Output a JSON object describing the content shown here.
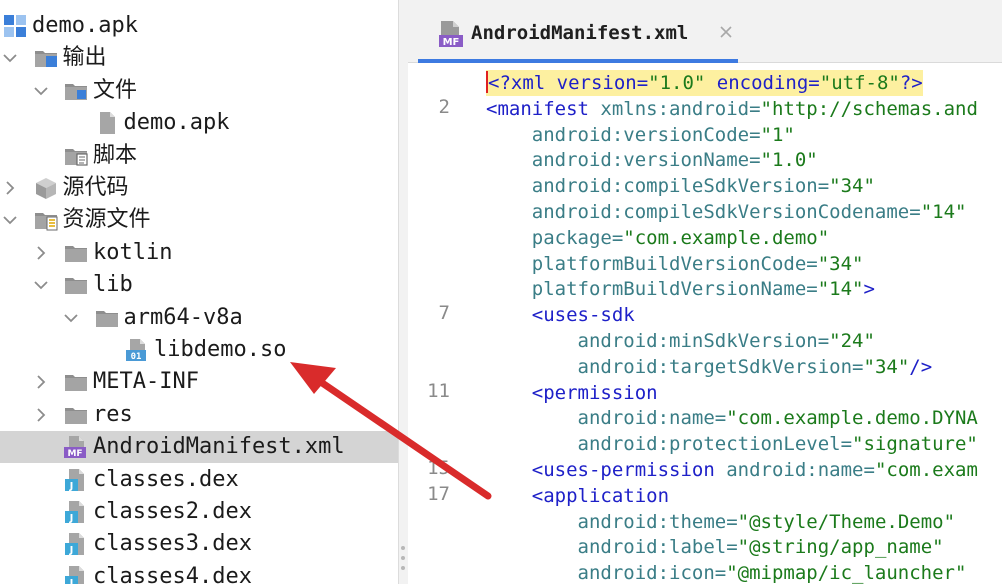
{
  "tree": {
    "items": [
      {
        "label": "demo.apk",
        "chevron": "none",
        "icon": "apk-module-icon",
        "depth": 0
      },
      {
        "label": "输出",
        "chevron": "down",
        "icon": "output-folder-icon",
        "depth": 1
      },
      {
        "label": "文件",
        "chevron": "down",
        "icon": "files-folder-icon",
        "depth": 2
      },
      {
        "label": "demo.apk",
        "chevron": "none",
        "icon": "file-icon",
        "depth": 3
      },
      {
        "label": "脚本",
        "chevron": "none",
        "icon": "script-folder-icon",
        "depth": 2
      },
      {
        "label": "源代码",
        "chevron": "right",
        "icon": "source-package-icon",
        "depth": 1
      },
      {
        "label": "资源文件",
        "chevron": "down",
        "icon": "resources-folder-icon",
        "depth": 1
      },
      {
        "label": "kotlin",
        "chevron": "right",
        "icon": "folder-icon",
        "depth": 2
      },
      {
        "label": "lib",
        "chevron": "down",
        "icon": "folder-icon",
        "depth": 2
      },
      {
        "label": "arm64-v8a",
        "chevron": "down",
        "icon": "folder-icon",
        "depth": 3
      },
      {
        "label": "libdemo.so",
        "chevron": "none",
        "icon": "binary-file-icon",
        "depth": 4
      },
      {
        "label": "META-INF",
        "chevron": "right",
        "icon": "folder-icon",
        "depth": 2
      },
      {
        "label": "res",
        "chevron": "right",
        "icon": "folder-icon",
        "depth": 2
      },
      {
        "label": "AndroidManifest.xml",
        "chevron": "none",
        "icon": "manifest-file-icon",
        "depth": 2,
        "selected": true
      },
      {
        "label": "classes.dex",
        "chevron": "none",
        "icon": "dex-file-icon",
        "depth": 2
      },
      {
        "label": "classes2.dex",
        "chevron": "none",
        "icon": "dex-file-icon",
        "depth": 2
      },
      {
        "label": "classes3.dex",
        "chevron": "none",
        "icon": "dex-file-icon",
        "depth": 2
      },
      {
        "label": "classes4.dex",
        "chevron": "none",
        "icon": "dex-file-icon",
        "depth": 2
      }
    ]
  },
  "icons": {
    "manifest_badge": "MF",
    "binary_badge": "01",
    "dex_badge": "J"
  },
  "editor": {
    "tab_label": "AndroidManifest.xml",
    "gutter": [
      {
        "line": 2,
        "row": 1
      },
      {
        "line": 7,
        "row": 9
      },
      {
        "line": 11,
        "row": 12
      },
      {
        "line": 15,
        "row": 15
      },
      {
        "line": 17,
        "row": 16
      }
    ],
    "code_lines": [
      [
        [
          "<?xml version=",
          "p"
        ],
        [
          "\"1.0\"",
          "v"
        ],
        [
          " encoding=",
          "p"
        ],
        [
          "\"utf-8\"",
          "v"
        ],
        [
          "?>",
          "p"
        ]
      ],
      [
        [
          "<manifest",
          "t"
        ],
        [
          " xmlns:android=",
          "a"
        ],
        [
          "\"http://schemas.and",
          "v"
        ]
      ],
      [
        [
          "    android:versionCode=",
          "a"
        ],
        [
          "\"1\"",
          "v"
        ]
      ],
      [
        [
          "    android:versionName=",
          "a"
        ],
        [
          "\"1.0\"",
          "v"
        ]
      ],
      [
        [
          "    android:compileSdkVersion=",
          "a"
        ],
        [
          "\"34\"",
          "v"
        ]
      ],
      [
        [
          "    android:compileSdkVersionCodename=",
          "a"
        ],
        [
          "\"14\"",
          "v"
        ]
      ],
      [
        [
          "    package=",
          "a"
        ],
        [
          "\"com.example.demo\"",
          "v"
        ]
      ],
      [
        [
          "    platformBuildVersionCode=",
          "a"
        ],
        [
          "\"34\"",
          "v"
        ]
      ],
      [
        [
          "    platformBuildVersionName=",
          "a"
        ],
        [
          "\"14\"",
          "v"
        ],
        [
          ">",
          "t"
        ]
      ],
      [
        [
          "    <uses-sdk",
          "t"
        ]
      ],
      [
        [
          "        android:minSdkVersion=",
          "a"
        ],
        [
          "\"24\"",
          "v"
        ]
      ],
      [
        [
          "        android:targetSdkVersion=",
          "a"
        ],
        [
          "\"34\"",
          "v"
        ],
        [
          "/>",
          "t"
        ]
      ],
      [
        [
          "    <permission",
          "t"
        ]
      ],
      [
        [
          "        android:name=",
          "a"
        ],
        [
          "\"com.example.demo.DYNA",
          "v"
        ]
      ],
      [
        [
          "        android:protectionLevel=",
          "a"
        ],
        [
          "\"signature\"",
          "v"
        ]
      ],
      [
        [
          "    <uses-permission",
          "t"
        ],
        [
          " android:name=",
          "a"
        ],
        [
          "\"com.exam",
          "v"
        ]
      ],
      [
        [
          "    <application",
          "t"
        ]
      ],
      [
        [
          "        android:theme=",
          "a"
        ],
        [
          "\"@style/Theme.Demo\"",
          "v"
        ]
      ],
      [
        [
          "        android:label=",
          "a"
        ],
        [
          "\"@string/app_name\"",
          "v"
        ]
      ],
      [
        [
          "        android:icon=",
          "a"
        ],
        [
          "\"@mipmap/ic_launcher\"",
          "v"
        ]
      ]
    ]
  },
  "colors": {
    "selection": "#d4d4d4",
    "tab_accent": "#3d7ae1",
    "line_highlight": "#fdf0a0",
    "tag": "#1e20c8",
    "attribute": "#3a7d86",
    "value": "#1b7a1b",
    "annotation_arrow": "#d92b2b"
  }
}
